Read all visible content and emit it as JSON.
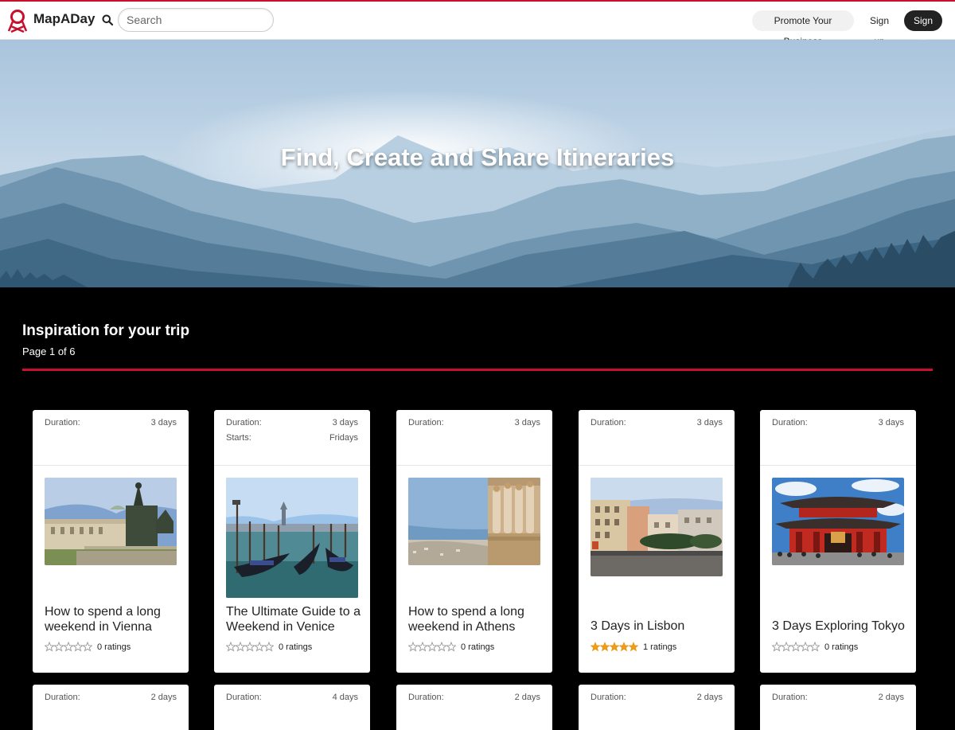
{
  "header": {
    "brand": "MapADay",
    "search_placeholder": "Search",
    "promote_label": "Promote Your Business",
    "signup_label": "Sign up",
    "signin_label": "Sign in",
    "accent": "#c8102e"
  },
  "hero": {
    "title": "Find, Create and Share Itineraries"
  },
  "section": {
    "title": "Inspiration for your trip",
    "page_info": "Page 1 of 6"
  },
  "cards": [
    {
      "duration_label": "Duration:",
      "duration": "3 days",
      "starts_label": "",
      "starts": "",
      "title": "How to spend a long weekend in Vienna",
      "rating_value": 0,
      "ratings_text": "0 ratings",
      "image": "vienna-statue-photo"
    },
    {
      "duration_label": "Duration:",
      "duration": "3 days",
      "starts_label": "Starts:",
      "starts": "Fridays",
      "title": "The Ultimate Guide to a Weekend in Venice",
      "rating_value": 0,
      "ratings_text": "0 ratings",
      "image": "venice-gondolas-photo"
    },
    {
      "duration_label": "Duration:",
      "duration": "3 days",
      "starts_label": "",
      "starts": "",
      "title": "How to spend a long weekend in Athens",
      "rating_value": 0,
      "ratings_text": "0 ratings",
      "image": "athens-caryatids-photo"
    },
    {
      "duration_label": "Duration:",
      "duration": "3 days",
      "starts_label": "",
      "starts": "",
      "title": "3 Days in Lisbon",
      "rating_value": 5,
      "ratings_text": "1 ratings",
      "image": "lisbon-square-photo"
    },
    {
      "duration_label": "Duration:",
      "duration": "3 days",
      "starts_label": "",
      "starts": "",
      "title": "3 Days Exploring Tokyo",
      "rating_value": 0,
      "ratings_text": "0 ratings",
      "image": "tokyo-temple-photo"
    }
  ],
  "cards_row2": [
    {
      "duration_label": "Duration:",
      "duration": "2 days"
    },
    {
      "duration_label": "Duration:",
      "duration": "4 days"
    },
    {
      "duration_label": "Duration:",
      "duration": "2 days"
    },
    {
      "duration_label": "Duration:",
      "duration": "2 days"
    },
    {
      "duration_label": "Duration:",
      "duration": "2 days"
    }
  ],
  "colors": {
    "star_filled": "#f39c12",
    "star_empty": "#999999"
  }
}
